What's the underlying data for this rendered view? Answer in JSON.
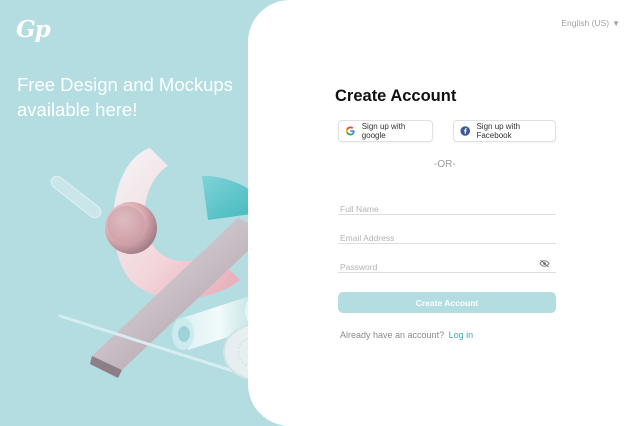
{
  "brand": {
    "logo_text": "Gp"
  },
  "promo": {
    "headline": "Free Design and Mockups available here!"
  },
  "header": {
    "language": "English (US)"
  },
  "form": {
    "title": "Create Account",
    "google_label": "Sign up with google",
    "facebook_label": "Sign up with Facebook",
    "divider": "-OR-",
    "full_name_placeholder": "Full Name",
    "email_placeholder": "Email Address",
    "password_placeholder": "Password",
    "submit_label": "Create Account",
    "login_prompt": "Already have an account?",
    "login_link": "Log in"
  },
  "colors": {
    "accent": "#b3dde0",
    "link": "#3fa9b5",
    "facebook": "#3b5998"
  }
}
